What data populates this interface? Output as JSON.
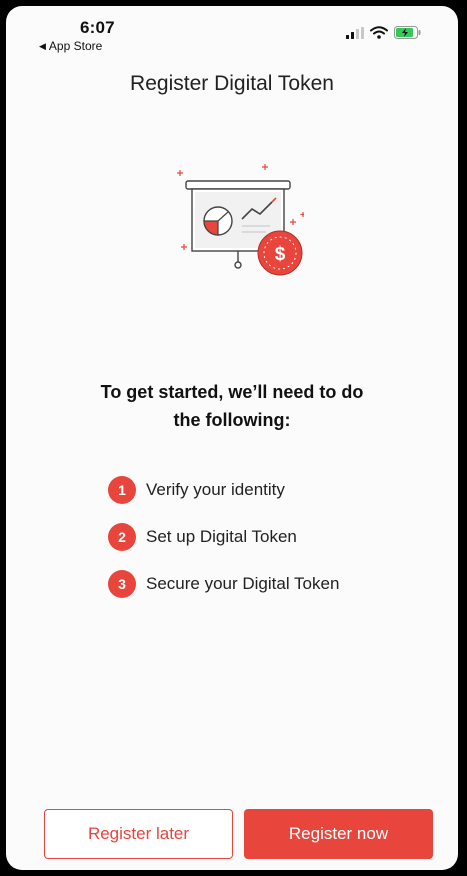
{
  "status_bar": {
    "time": "6:07",
    "back_app": "App Store"
  },
  "header": {
    "title": "Register Digital Token"
  },
  "illustration": {
    "icon": "presentation-board-with-dollar-coin",
    "coin_symbol": "$"
  },
  "content": {
    "heading": "To get started, we’ll need to do the following:",
    "steps": [
      {
        "number": "1",
        "label": "Verify your identity"
      },
      {
        "number": "2",
        "label": "Set up Digital Token"
      },
      {
        "number": "3",
        "label": "Secure your Digital Token"
      }
    ]
  },
  "actions": {
    "register_later": "Register later",
    "register_now": "Register now"
  },
  "colors": {
    "accent": "#e8453c",
    "background": "#fbfbfb"
  }
}
